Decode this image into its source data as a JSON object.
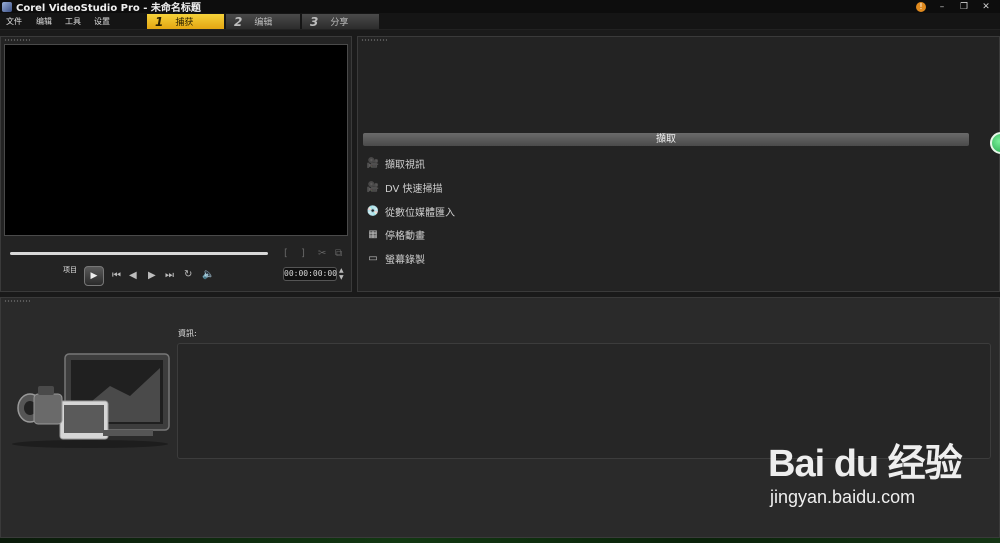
{
  "window": {
    "title": "Corel VideoStudio Pro - 未命名标题"
  },
  "menu": {
    "file": "文件",
    "edit": "编辑",
    "tools": "工具",
    "settings": "设置"
  },
  "steps": [
    {
      "num": "1",
      "label": "捕获"
    },
    {
      "num": "2",
      "label": "编辑"
    },
    {
      "num": "3",
      "label": "分享"
    }
  ],
  "player": {
    "project_label": "项目",
    "timecode": "00:00:00:00"
  },
  "capture": {
    "header": "擷取",
    "items": [
      {
        "label": "擷取視訊",
        "icon": "video-camera-icon"
      },
      {
        "label": "DV 快速掃描",
        "icon": "dv-camera-icon"
      },
      {
        "label": "從數位媒體匯入",
        "icon": "disc-import-icon"
      },
      {
        "label": "停格動畫",
        "icon": "stop-motion-icon"
      },
      {
        "label": "螢幕錄製",
        "icon": "screen-record-icon"
      }
    ]
  },
  "info": {
    "label": "資訊:"
  },
  "watermark": {
    "brand": "Bai du 经验",
    "url": "jingyan.baidu.com"
  }
}
